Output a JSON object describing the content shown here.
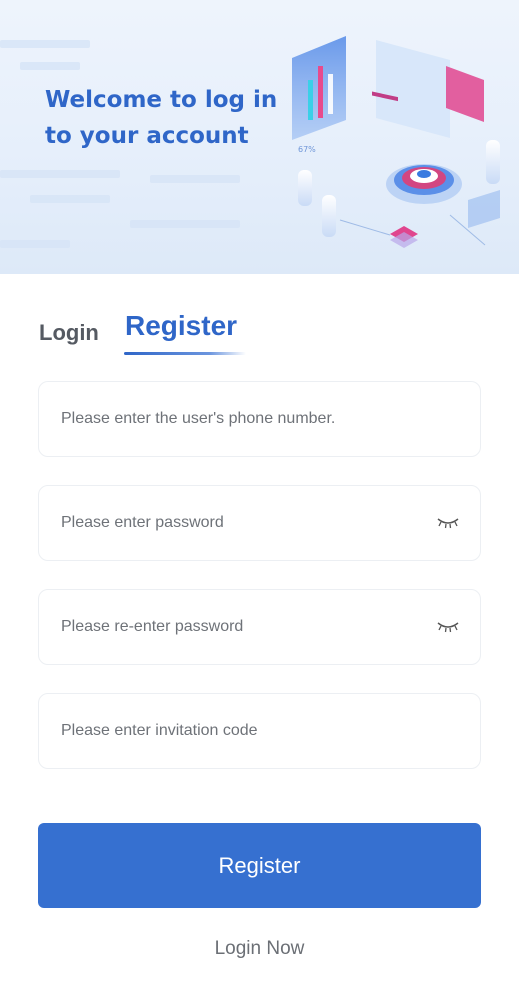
{
  "hero": {
    "welcome_text": "Welcome to log in\nto your account",
    "chart_badge": "67%"
  },
  "tabs": {
    "login_label": "Login",
    "register_label": "Register",
    "active": "register"
  },
  "form": {
    "phone_placeholder": "Please enter the user's phone number.",
    "password_placeholder": "Please enter password",
    "confirm_password_placeholder": "Please re-enter password",
    "invitation_placeholder": "Please enter invitation code",
    "password_icon": "eye-closed-icon",
    "confirm_password_icon": "eye-closed-icon"
  },
  "actions": {
    "register_button_label": "Register",
    "login_now_label": "Login Now"
  },
  "colors": {
    "primary": "#3670d0",
    "accent_text": "#2f66c8",
    "muted_text": "#6e7278"
  }
}
